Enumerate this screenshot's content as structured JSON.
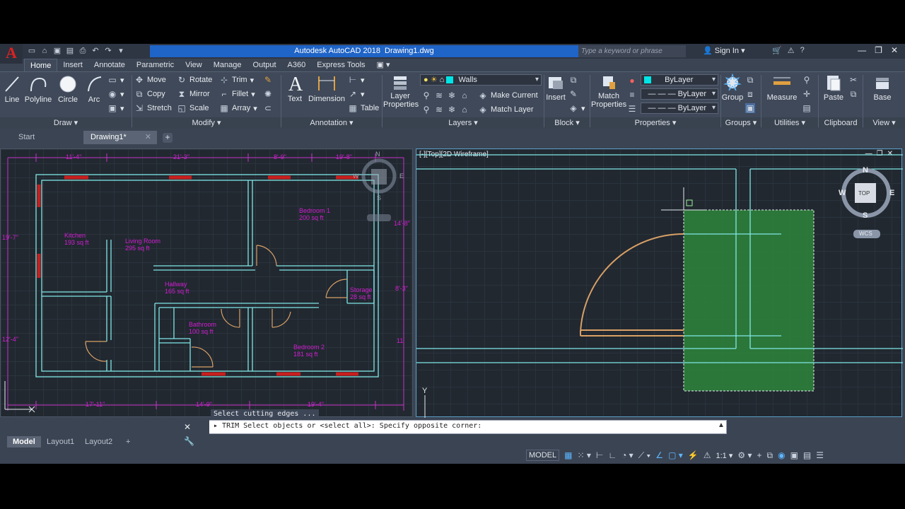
{
  "app": {
    "product": "Autodesk AutoCAD 2018",
    "filename": "Drawing1.dwg",
    "logo_letter": "A",
    "search_placeholder": "Type a keyword or phrase",
    "sign_in": "Sign In"
  },
  "menu_tabs": [
    "Home",
    "Insert",
    "Annotate",
    "Parametric",
    "View",
    "Manage",
    "Output",
    "A360",
    "Express Tools"
  ],
  "ribbon": {
    "draw": {
      "line": "Line",
      "polyline": "Polyline",
      "circle": "Circle",
      "arc": "Arc",
      "footer": "Draw ▾"
    },
    "modify": {
      "move": "Move",
      "rotate": "Rotate",
      "trim": "Trim",
      "copy": "Copy",
      "mirror": "Mirror",
      "fillet": "Fillet",
      "stretch": "Stretch",
      "scale": "Scale",
      "array": "Array",
      "footer": "Modify ▾"
    },
    "annotation": {
      "text": "Text",
      "dimension": "Dimension",
      "table": "Table",
      "footer": "Annotation ▾"
    },
    "layers": {
      "layer_properties": "Layer Properties",
      "current_layer": "Walls",
      "make_current": "Make Current",
      "match_layer": "Match Layer",
      "footer": "Layers ▾"
    },
    "block": {
      "insert": "Insert",
      "footer": "Block ▾"
    },
    "properties": {
      "match_properties": "Match Properties",
      "color": "ByLayer",
      "linetype": "ByLayer",
      "lineweight": "ByLayer",
      "footer": "Properties ▾"
    },
    "groups": {
      "group": "Group",
      "footer": "Groups ▾"
    },
    "utilities": {
      "measure": "Measure",
      "footer": "Utilities ▾"
    },
    "clipboard": {
      "paste": "Paste",
      "footer": "Clipboard"
    },
    "view": {
      "base": "Base",
      "footer": "View ▾"
    }
  },
  "file_tabs": {
    "start": "Start",
    "drawing": "Drawing1*"
  },
  "left_viewport": {
    "rooms": [
      {
        "name": "Kitchen",
        "area": "193 sq ft"
      },
      {
        "name": "Living Room",
        "area": "295 sq ft"
      },
      {
        "name": "Bedroom 1",
        "area": "200 sq ft"
      },
      {
        "name": "Hallway",
        "area": "165 sq ft"
      },
      {
        "name": "Storage",
        "area": "28 sq ft"
      },
      {
        "name": "Bathroom",
        "area": "100 sq ft"
      },
      {
        "name": "Bedroom 2",
        "area": "181 sq ft"
      }
    ],
    "dims_top": [
      "11'-4\"",
      "21'-3\"",
      "8'-9\"",
      "19'-8\""
    ],
    "dims_bottom": [
      "17'-11\"",
      "14'-9\"",
      "19'-4\""
    ],
    "dims_left": [
      "19'-7\"",
      "12'-4\""
    ],
    "dims_right": [
      "14'-8\"",
      "8'-3\"",
      "11'"
    ],
    "compass": {
      "n": "N",
      "w": "W",
      "e": "E",
      "s": "S"
    },
    "history": "Select cutting edges ..."
  },
  "right_viewport": {
    "label": "[-][Top][2D Wireframe]",
    "viewcube": {
      "n": "N",
      "s": "S",
      "w": "W",
      "e": "E",
      "top": "TOP",
      "wcs": "WCS"
    },
    "ucs_y": "Y"
  },
  "command": {
    "prompt": "TRIM Select objects or <select all>: Specify opposite corner:"
  },
  "layout_tabs": [
    "Model",
    "Layout1",
    "Layout2"
  ],
  "status": {
    "mode": "MODEL",
    "scale": "1:1"
  },
  "colors": {
    "accent": "#1f64c7",
    "wall": "#7fe6e6",
    "text": "#d21ed2",
    "door": "#d9a066",
    "selection": "#2e8b3c"
  }
}
